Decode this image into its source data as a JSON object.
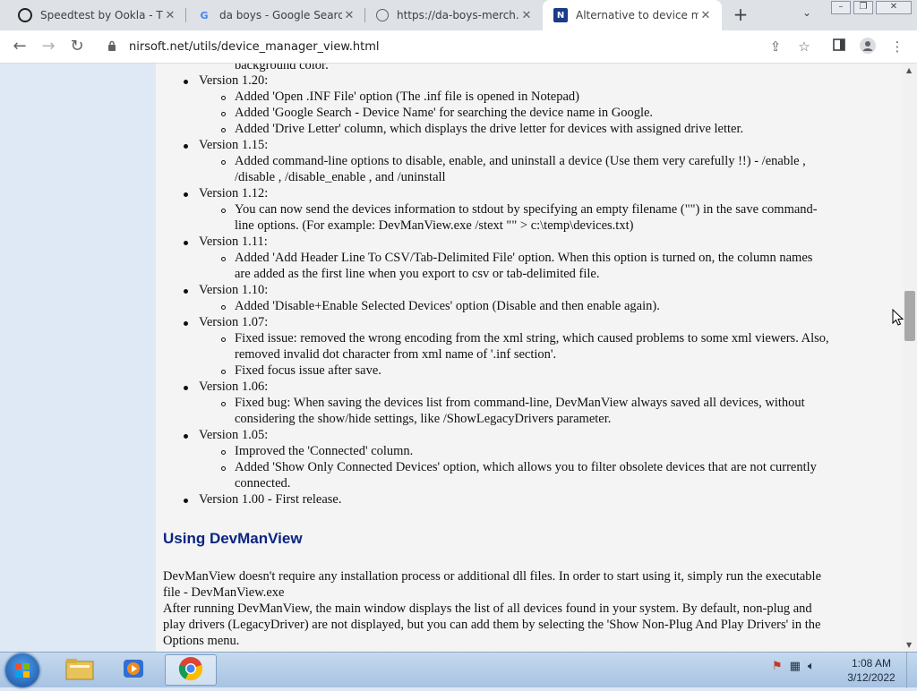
{
  "browser": {
    "tabs": [
      {
        "title": "Speedtest by Ookla - The",
        "favicon": "speedtest-icon",
        "active": false
      },
      {
        "title": "da boys - Google Search",
        "favicon": "google-icon",
        "active": false
      },
      {
        "title": "https://da-boys-merch.c",
        "favicon": "globe-icon",
        "active": false
      },
      {
        "title": "Alternative to device man",
        "favicon": "nirsoft-icon",
        "active": true
      }
    ],
    "new_tab_label": "+",
    "url": "nirsoft.net/utils/device_manager_view.html"
  },
  "page": {
    "top_line": "background color.",
    "changelog": [
      {
        "version": "Version 1.20:",
        "items": [
          [
            "Added 'Open .INF File' option (The .inf file is opened in Notepad)"
          ],
          [
            "Added 'Google Search - Device Name' for searching the device name in Google."
          ],
          [
            "Added 'Drive Letter' column, which displays the drive letter for devices with assigned drive letter."
          ]
        ]
      },
      {
        "version": "Version 1.15:",
        "items": [
          [
            "Added command-line options to disable, enable, and uninstall a device (Use them very carefully !!) - /enable ,",
            "/disable , /disable_enable , and /uninstall"
          ]
        ]
      },
      {
        "version": "Version 1.12:",
        "items": [
          [
            "You can now send the devices information to stdout by specifying an empty filename (\"\") in the save command-",
            "line options. (For example: DevManView.exe /stext \"\" > c:\\temp\\devices.txt)"
          ]
        ]
      },
      {
        "version": "Version 1.11:",
        "items": [
          [
            "Added 'Add Header Line To CSV/Tab-Delimited File' option. When this option is turned on, the column names",
            "are added as the first line when you export to csv or tab-delimited file."
          ]
        ]
      },
      {
        "version": "Version 1.10:",
        "items": [
          [
            "Added 'Disable+Enable Selected Devices' option (Disable and then enable again)."
          ]
        ]
      },
      {
        "version": "Version 1.07:",
        "items": [
          [
            "Fixed issue: removed the wrong encoding from the xml string, which caused problems to some xml viewers. Also,",
            "removed invalid dot character from xml name of '.inf section'."
          ],
          [
            "Fixed focus issue after save."
          ]
        ]
      },
      {
        "version": "Version 1.06:",
        "items": [
          [
            "Fixed bug: When saving the devices list from command-line, DevManView always saved all devices, without",
            "considering the show/hide settings, like /ShowLegacyDrivers parameter."
          ]
        ]
      },
      {
        "version": "Version 1.05:",
        "items": [
          [
            "Improved the 'Connected' column."
          ],
          [
            "Added 'Show Only Connected Devices' option, which allows you to filter obsolete devices that are not currently",
            "connected."
          ]
        ]
      },
      {
        "version": "Version 1.00 - First release.",
        "items": []
      }
    ],
    "section_heading": "Using DevManView",
    "paragraphs": [
      [
        "DevManView doesn't require any installation process or additional dll files. In order to start using it, simply run the executable",
        "file - DevManView.exe"
      ],
      [
        "After running DevManView, the main window displays the list of all devices found in your system. By default, non-plug and",
        "play drivers (LegacyDriver) are not displayed, but you can add them by selecting the 'Show Non-Plug And Play Drivers' in the",
        "Options menu."
      ]
    ]
  },
  "taskbar": {
    "apps": [
      {
        "name": "file-explorer-icon",
        "active": false
      },
      {
        "name": "media-player-icon",
        "active": false
      },
      {
        "name": "chrome-icon",
        "active": true
      }
    ],
    "time": "1:08 AM",
    "date": "3/12/2022"
  }
}
